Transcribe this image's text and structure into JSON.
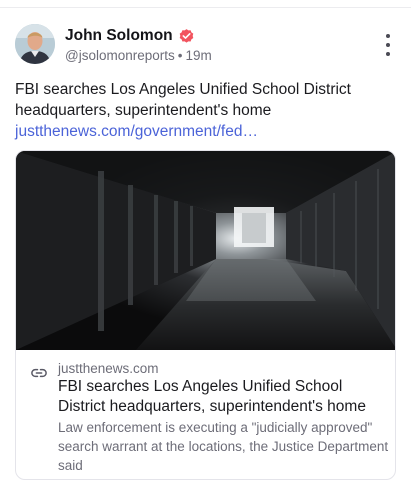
{
  "author": {
    "display_name": "John Solomon",
    "handle": "@jsolomonreports",
    "separator": "•",
    "time": "19m",
    "avatar_icon": "person-avatar",
    "verified_icon": "verified-check-icon",
    "verified_color": "#f2545f"
  },
  "post": {
    "text": "FBI searches Los Angeles Unified School District headquarters, superintendent's home",
    "link": "justthenews.com/government/fed…",
    "link_color": "#4b63d8"
  },
  "card": {
    "link_icon": "link-icon",
    "domain": "justthenews.com",
    "title": "FBI searches Los Angeles Unified School District headquarters, superintendent's home",
    "description": "Law enforcement is executing a \"judicially approved\" search warrant at the locations, the Justice Department said",
    "image_description": "dark school hallway with lockers"
  },
  "menu_icon": "more-vertical-icon"
}
